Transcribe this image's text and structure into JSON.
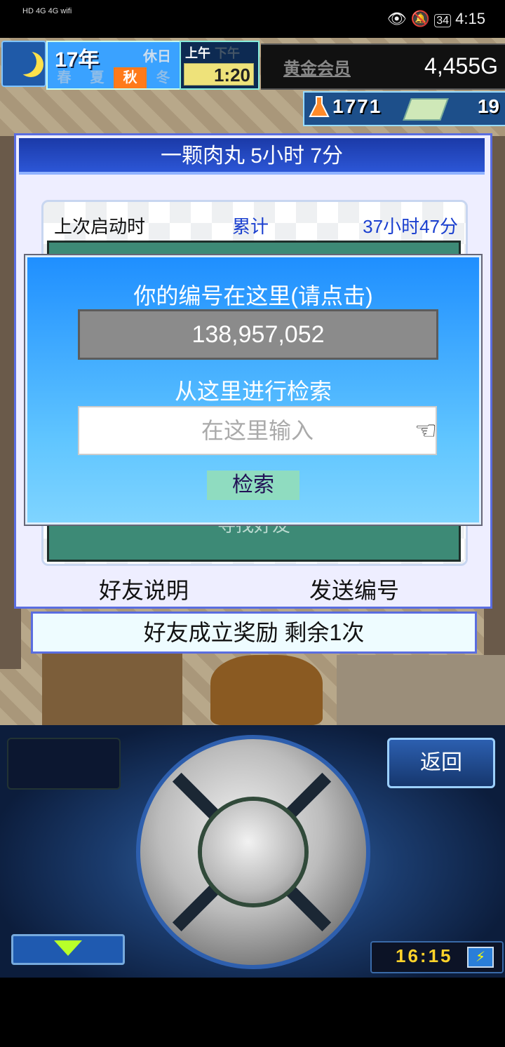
{
  "status_bar": {
    "left_icons": "HD 4G 4G wifi",
    "right_text": "34",
    "time": "4:15"
  },
  "hud": {
    "year": "17年",
    "holiday": "休日",
    "seasons": [
      "春",
      "夏",
      "秋",
      "冬"
    ],
    "active_season": "秋",
    "am": "上午",
    "pm": "下午",
    "clock": "1:20",
    "membership": "黄金会员",
    "money": "4,455G",
    "stat1": "1771",
    "stat2": "19"
  },
  "friend_panel": {
    "title": "一颗肉丸  5小时 7分",
    "last_start_label": "上次启动时",
    "cumulative_label": "累计",
    "cumulative_value": "37小时47分",
    "find_friend": "寻找好友",
    "friend_explanation": "好友说明",
    "send_id": "发送编号",
    "reward": "好友成立奖励  剩余1次"
  },
  "id_dialog": {
    "your_id_label": "你的编号在这里(请点击)",
    "id_value": "138,957,052",
    "search_from_here": "从这里进行检索",
    "input_placeholder": "在这里输入",
    "search_button": "检索"
  },
  "controls": {
    "back_button": "返回",
    "bottom_clock": "16:15"
  },
  "colors": {
    "dialog_blue": "#1f8fff",
    "panel_title_blue": "#1b3aa8",
    "search_green": "#8fdcc0",
    "link_blue": "#1a3fcf"
  }
}
